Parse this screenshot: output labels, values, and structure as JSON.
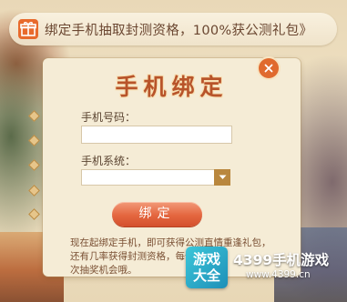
{
  "banner": {
    "text": "绑定手机抽取封测资格，100%获公测礼包》",
    "icon": "gift-icon"
  },
  "modal": {
    "title": "手机绑定",
    "close_icon": "close-icon",
    "phone_label": "手机号码：",
    "phone_value": "",
    "system_label": "手机系统：",
    "system_selected": "",
    "bind_label": "绑定",
    "notice_lines": [
      "现在起绑定手机，即可获得公测直情重逢礼包，",
      "还有几率获得封测资格，每个",
      "次抽奖机会哦。"
    ]
  },
  "watermark": {
    "logo_line1": "游戏",
    "logo_line2": "大全",
    "name": "4399手机游戏",
    "url": "www.4399.cn"
  },
  "colors": {
    "accent": "#e4663f",
    "title": "#b8542a",
    "panel": "#f5ecd6"
  }
}
